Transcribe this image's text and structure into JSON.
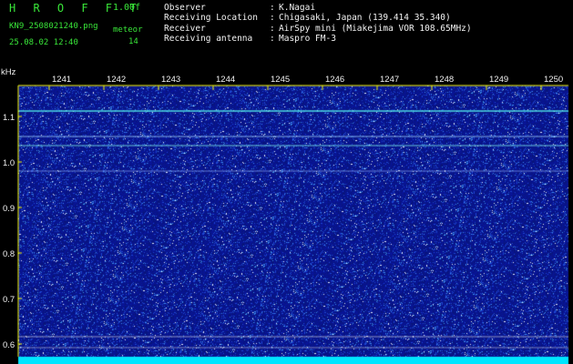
{
  "header": {
    "app_title": "HROFFT",
    "version": "1.00f",
    "filename": "KN9_2508021240.png",
    "mode": "meteor",
    "datetime": "25.08.02 12:40",
    "count": "14",
    "info": [
      {
        "label": "Observer",
        "value": "K.Nagai"
      },
      {
        "label": "Receiving Location",
        "value": "Chigasaki, Japan (139.414 35.340)"
      },
      {
        "label": "Receiver",
        "value": "AirSpy mini (Miakejima VOR 108.65MHz)"
      },
      {
        "label": "Receiving antenna",
        "value": "Maspro FM-3"
      }
    ]
  },
  "spectrogram": {
    "unit": "kHz",
    "x_ticks": [
      "1241",
      "1242",
      "1243",
      "1244",
      "1245",
      "1246",
      "1247",
      "1248",
      "1249",
      "1250"
    ],
    "y_ticks": [
      "1.1",
      "1.0",
      "0.9",
      "0.8",
      "0.7",
      "0.6"
    ],
    "colors": {
      "background": "#000000",
      "noise_base": "#0d1c8c",
      "axis": "#ffff00",
      "text": "#f2f2f2",
      "header_green": "#39e639",
      "baseline": "#00e5ff"
    }
  }
}
